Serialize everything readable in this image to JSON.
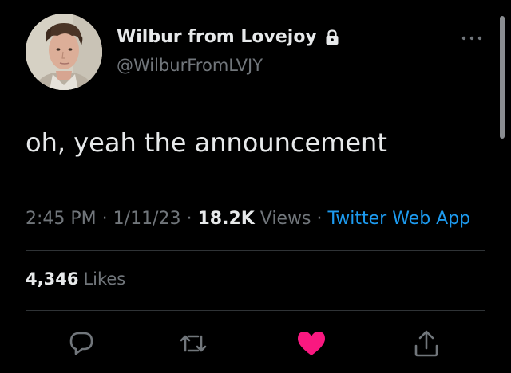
{
  "author": {
    "display_name": "Wilbur from Lovejoy",
    "handle": "@WilburFromLVJY",
    "protected_icon": "lock-icon"
  },
  "tweet": {
    "text": "oh, yeah the announcement"
  },
  "meta": {
    "time": "2:45 PM",
    "date": "1/11/23",
    "views_count": "18.2K",
    "views_label": "Views",
    "source": "Twitter Web App",
    "separator": "·"
  },
  "likes": {
    "count": "4,346",
    "label": "Likes"
  },
  "actions": {
    "reply_icon": "reply-icon",
    "retweet_icon": "retweet-icon",
    "like_icon": "heart-icon",
    "share_icon": "share-icon"
  },
  "colors": {
    "background": "#000000",
    "primary_text": "#e7e9ea",
    "secondary_text": "#71767b",
    "link": "#1d9bf0",
    "like": "#f91880",
    "divider": "#2f3336"
  }
}
